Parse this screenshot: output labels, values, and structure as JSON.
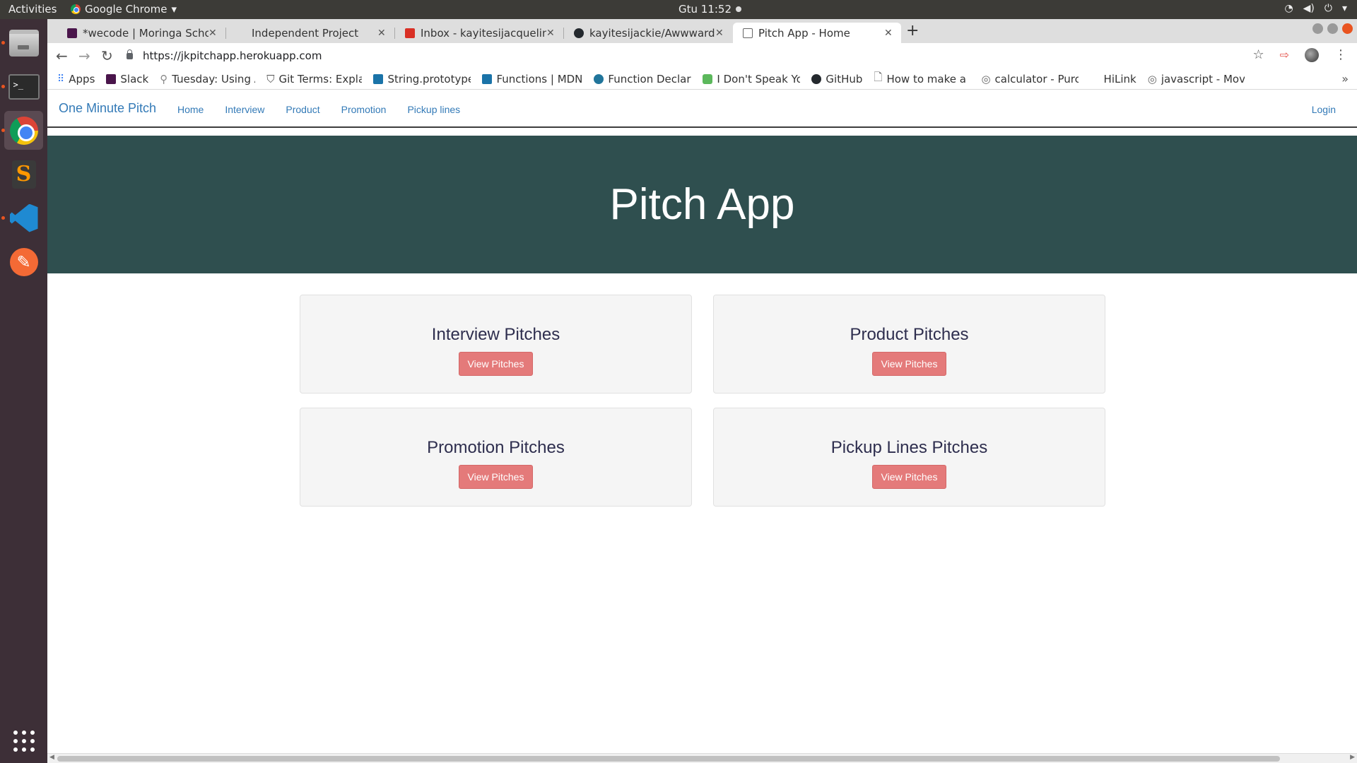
{
  "system": {
    "activities": "Activities",
    "app_name": "Google Chrome",
    "clock": "Gtu 11:52"
  },
  "tabs": [
    {
      "label": "*wecode | Moringa School",
      "favicon_color": "#4a154b"
    },
    {
      "label": "Independent Project",
      "favicon_color": "#dedede"
    },
    {
      "label": "Inbox - kayitesijacqueline",
      "favicon_color": "#d93025"
    },
    {
      "label": "kayitesijackie/Awwwards",
      "favicon_color": "#24292e"
    },
    {
      "label": "Pitch App - Home",
      "favicon_color": "#ffffff"
    }
  ],
  "address": {
    "url": "https://jkpitchapp.herokuapp.com"
  },
  "bookmarks": [
    {
      "label": "Apps",
      "icon": "apps-grid-icon",
      "color": "#4285f4"
    },
    {
      "label": "Slack",
      "icon": "slack-icon",
      "color": "#4a154b"
    },
    {
      "label": "Tuesday: Using A",
      "icon": "pin-icon",
      "color": "#888888"
    },
    {
      "label": "Git Terms: Explai",
      "icon": "cap-icon",
      "color": "#555555"
    },
    {
      "label": "String.prototype",
      "icon": "mdn-icon",
      "color": "#1a73a8"
    },
    {
      "label": "Functions | MDN",
      "icon": "mdn-icon",
      "color": "#1a73a8"
    },
    {
      "label": "Function Declara",
      "icon": "wordpress-icon",
      "color": "#21759b"
    },
    {
      "label": "I Don't Speak Yo",
      "icon": "hex-icon",
      "color": "#5cb85c"
    },
    {
      "label": "GitHub",
      "icon": "github-icon",
      "color": "#24292e"
    },
    {
      "label": "How to make a s",
      "icon": "page-icon",
      "color": "#666666"
    },
    {
      "label": "calculator - Purcl",
      "icon": "globe-icon",
      "color": "#666666"
    },
    {
      "label": "HiLink",
      "icon": "none",
      "color": "#ffffff"
    },
    {
      "label": "javascript - Movi",
      "icon": "globe-icon",
      "color": "#666666"
    }
  ],
  "site": {
    "brand": "One Minute Pitch",
    "nav": [
      "Home",
      "Interview",
      "Product",
      "Promotion",
      "Pickup lines"
    ],
    "login": "Login",
    "hero_title": "Pitch App"
  },
  "cards": [
    {
      "title": "Interview Pitches",
      "button": "View Pitches"
    },
    {
      "title": "Product Pitches",
      "button": "View Pitches"
    },
    {
      "title": "Promotion Pitches",
      "button": "View Pitches"
    },
    {
      "title": "Pickup Lines Pitches",
      "button": "View Pitches"
    }
  ],
  "colors": {
    "hero_bg": "#2f4f4f",
    "button_bg": "#e47a7a",
    "link": "#337ab7"
  }
}
